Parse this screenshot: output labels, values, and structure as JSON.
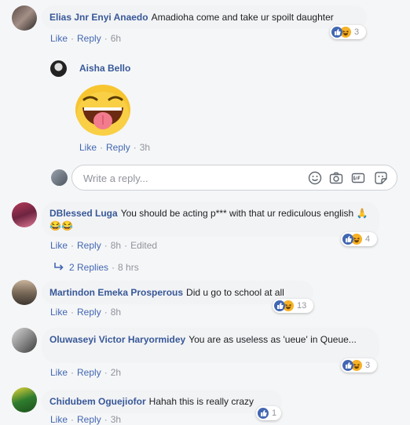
{
  "comments": [
    {
      "author": "Elias Jnr Enyi Anaedo",
      "text": "Amadioha come and take ur spoilt daughter",
      "reaction_count": "3",
      "time": "6h"
    },
    {
      "author": "DBlessed Luga",
      "text": "You should be acting p*** with that ur rediculous english 🙏😂😂",
      "reaction_count": "4",
      "time": "8h",
      "edited": "Edited",
      "replies_label": "2 Replies",
      "replies_time": "8 hrs"
    },
    {
      "author": "Martindon Emeka Prosperous",
      "text": "Did u go to school at all",
      "reaction_count": "13",
      "time": "8h"
    },
    {
      "author": "Oluwaseyi Victor Haryormidey",
      "text": "You are as useless as 'ueue' in Queue...",
      "reaction_count": "3",
      "time": "2h"
    },
    {
      "author": "Chidubem Oguejiofor",
      "text": "Hahah this is really crazy",
      "reaction_count": "1",
      "time": "3h"
    }
  ],
  "nested_reply": {
    "author": "Aisha Bello",
    "sticker": "tongue-out-laughing-sticker",
    "time": "3h"
  },
  "actions": {
    "like": "Like",
    "reply": "Reply",
    "dot": "·"
  },
  "reply_input": {
    "placeholder": "Write a reply..."
  },
  "colors": {
    "link": "#385898",
    "action": "#4267b2",
    "bubble": "#f2f3f5",
    "like_icon": "#4267b2",
    "haha_icon": "#f7b125"
  }
}
